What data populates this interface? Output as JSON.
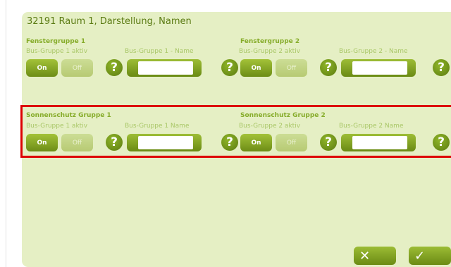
{
  "panel": {
    "title": "32191 Raum 1, Darstellung, Namen"
  },
  "groups": [
    {
      "heading": "Fenstergruppe 1",
      "active_label": "Bus-Gruppe 1 aktiv",
      "name_label": "Bus-Gruppe 1 - Name",
      "on_label": "On",
      "off_label": "Off",
      "help": "?",
      "name_value": ""
    },
    {
      "heading": "Fenstergruppe 2",
      "active_label": "Bus-Gruppe 2 aktiv",
      "name_label": "Bus-Gruppe 2 - Name",
      "on_label": "On",
      "off_label": "Off",
      "help": "?",
      "name_value": ""
    },
    {
      "heading": "Sonnenschutz Gruppe 1",
      "active_label": "Bus-Gruppe 1 aktiv",
      "name_label": "Bus-Gruppe 1 Name",
      "on_label": "On",
      "off_label": "Off",
      "help": "?",
      "name_value": ""
    },
    {
      "heading": "Sonnenschutz Gruppe 2",
      "active_label": "Bus-Gruppe 2 aktiv",
      "name_label": "Bus-Gruppe 2 Name",
      "on_label": "On",
      "off_label": "Off",
      "help": "?",
      "name_value": ""
    }
  ],
  "footer": {
    "cancel_glyph": "✕",
    "confirm_glyph": "✓"
  },
  "colors": {
    "panel_bg": "#e5efc4",
    "accent": "#7a9a1c",
    "selection_border": "#dd0000"
  },
  "icons": {
    "help": "question-icon",
    "cancel": "close-icon",
    "confirm": "check-icon"
  }
}
